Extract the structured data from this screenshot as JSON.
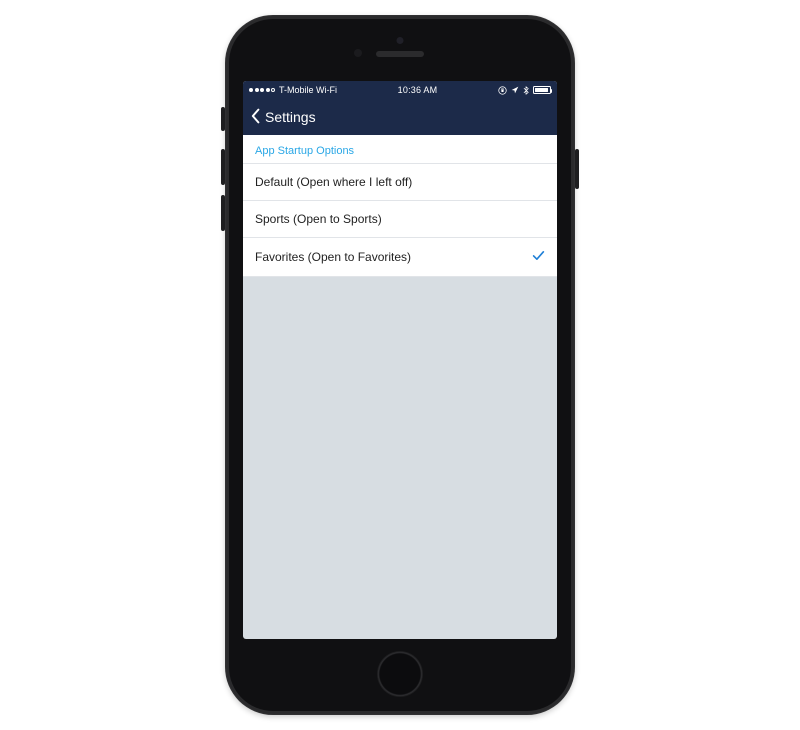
{
  "statusBar": {
    "carrier": "T-Mobile Wi-Fi",
    "time": "10:36 AM"
  },
  "navBar": {
    "backLabel": "Settings"
  },
  "section": {
    "header": "App Startup Options",
    "options": [
      {
        "label": "Default (Open where I left off)",
        "selected": false
      },
      {
        "label": "Sports (Open to Sports)",
        "selected": false
      },
      {
        "label": "Favorites (Open to Favorites)",
        "selected": true
      }
    ]
  }
}
